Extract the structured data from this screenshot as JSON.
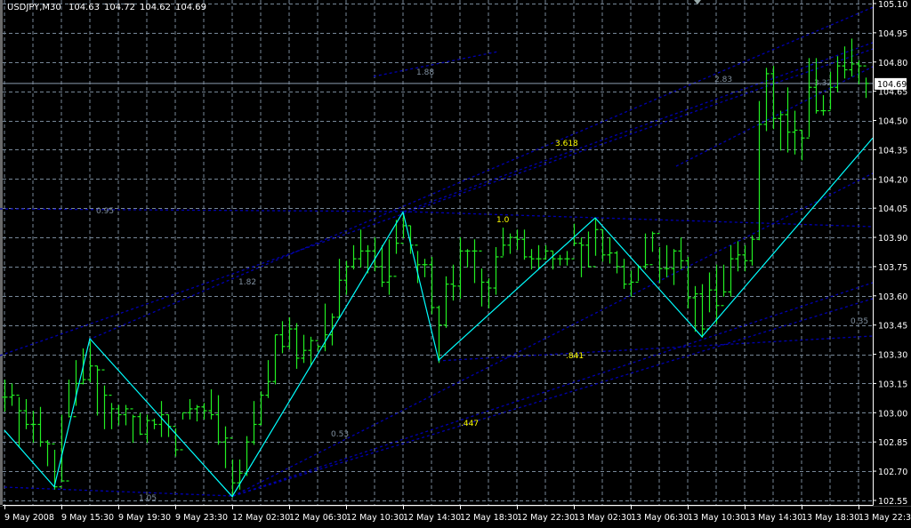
{
  "header": {
    "symbol": "USDJPY,M30",
    "open": "104.63",
    "high": "104.72",
    "low": "104.62",
    "close": "104.69"
  },
  "colors": {
    "background": "#000000",
    "grid": "#778899",
    "bars": "#22ee22",
    "zigzag": "#00ffff",
    "fib_lines": "#0000b0",
    "fib_label_gray": "#8090a0",
    "fib_label_yellow": "#ffff00",
    "axis": "#ffffff",
    "current_price_line": "#8c9cb0"
  },
  "chart_data": {
    "type": "ohlc-bar",
    "instrument": "USDJPY",
    "timeframe": "M30",
    "ylim": [
      102.55,
      105.1
    ],
    "y_ticks": [
      "105.10",
      "104.95",
      "104.80",
      "104.65",
      "104.50",
      "104.35",
      "104.20",
      "104.05",
      "103.90",
      "103.75",
      "103.60",
      "103.45",
      "103.30",
      "103.15",
      "103.00",
      "102.85",
      "102.70",
      "102.55"
    ],
    "x_ticks": [
      "9 May 2008",
      "9 May 15:30",
      "9 May 19:30",
      "9 May 23:30",
      "12 May 02:30",
      "12 May 06:30",
      "12 May 10:30",
      "12 May 14:30",
      "12 May 18:30",
      "12 May 22:30",
      "13 May 02:30",
      "13 May 06:30",
      "13 May 10:30",
      "13 May 14:30",
      "13 May 18:30",
      "13 May 22:30"
    ],
    "grid": true,
    "current_price": "104.69",
    "bars_hlc": [
      [
        103.17,
        103.01,
        103.08
      ],
      [
        103.15,
        103.04,
        103.09
      ],
      [
        103.08,
        102.83,
        103.01
      ],
      [
        103.07,
        102.92,
        102.94
      ],
      [
        103.01,
        102.85,
        102.94
      ],
      [
        103.03,
        102.83,
        102.85
      ],
      [
        102.86,
        102.73,
        102.84
      ],
      [
        102.81,
        102.61,
        102.62
      ],
      [
        102.99,
        102.65,
        102.65
      ],
      [
        103.17,
        102.98,
        102.98
      ],
      [
        103.27,
        103.04,
        103.15
      ],
      [
        103.33,
        103.15,
        103.17
      ],
      [
        103.37,
        103.16,
        103.24
      ],
      [
        103.24,
        102.99,
        103.22
      ],
      [
        103.14,
        102.92,
        103.09
      ],
      [
        103.05,
        102.92,
        103.02
      ],
      [
        103.04,
        102.94,
        102.99
      ],
      [
        103.04,
        102.94,
        103.02
      ],
      [
        102.99,
        102.85,
        102.98
      ],
      [
        103.0,
        102.89,
        102.89
      ],
      [
        102.99,
        102.85,
        102.96
      ],
      [
        102.97,
        102.92,
        102.94
      ],
      [
        103.06,
        102.88,
        102.99
      ],
      [
        102.99,
        102.88,
        102.93
      ],
      [
        102.92,
        102.78,
        102.81
      ],
      [
        103.0,
        102.97,
        103.0
      ],
      [
        103.07,
        102.97,
        103.02
      ],
      [
        103.04,
        102.96,
        103.03
      ],
      [
        103.05,
        102.97,
        103.01
      ],
      [
        103.12,
        102.97,
        102.99
      ],
      [
        103.09,
        102.84,
        102.85
      ],
      [
        102.93,
        102.72,
        102.87
      ],
      [
        102.76,
        102.57,
        102.64
      ],
      [
        102.76,
        102.61,
        102.69
      ],
      [
        102.88,
        102.68,
        102.85
      ],
      [
        103.06,
        102.84,
        102.94
      ],
      [
        103.11,
        102.94,
        103.09
      ],
      [
        103.27,
        103.08,
        103.16
      ],
      [
        103.4,
        103.15,
        103.4
      ],
      [
        103.47,
        103.31,
        103.34
      ],
      [
        103.49,
        103.33,
        103.43
      ],
      [
        103.46,
        103.23,
        103.28
      ],
      [
        103.4,
        103.26,
        103.32
      ],
      [
        103.39,
        103.25,
        103.37
      ],
      [
        103.35,
        103.32,
        103.34
      ],
      [
        103.56,
        103.32,
        103.4
      ],
      [
        103.51,
        103.35,
        103.49
      ],
      [
        103.79,
        103.49,
        103.68
      ],
      [
        103.78,
        103.61,
        103.75
      ],
      [
        103.86,
        103.74,
        103.79
      ],
      [
        103.94,
        103.75,
        103.83
      ],
      [
        103.86,
        103.72,
        103.83
      ],
      [
        103.9,
        103.73,
        103.75
      ],
      [
        103.86,
        103.65,
        103.67
      ],
      [
        103.89,
        103.61,
        103.7
      ],
      [
        103.99,
        103.82,
        103.87
      ],
      [
        104.02,
        103.9,
        103.96
      ],
      [
        103.96,
        103.82,
        103.86
      ],
      [
        103.83,
        103.67,
        103.76
      ],
      [
        103.79,
        103.7,
        103.76
      ],
      [
        103.8,
        103.51,
        103.54
      ],
      [
        103.55,
        103.26,
        103.45
      ],
      [
        103.7,
        103.44,
        103.66
      ],
      [
        103.76,
        103.58,
        103.65
      ],
      [
        103.9,
        103.59,
        103.83
      ],
      [
        103.84,
        103.75,
        103.83
      ],
      [
        103.89,
        103.67,
        103.83
      ],
      [
        103.74,
        103.55,
        103.67
      ],
      [
        103.69,
        103.54,
        103.64
      ],
      [
        103.85,
        103.61,
        103.8
      ],
      [
        103.95,
        103.81,
        103.86
      ],
      [
        103.92,
        103.82,
        103.9
      ],
      [
        103.94,
        103.84,
        103.89
      ],
      [
        103.94,
        103.79,
        103.8
      ],
      [
        103.84,
        103.74,
        103.79
      ],
      [
        103.86,
        103.74,
        103.79
      ],
      [
        103.86,
        103.79,
        103.83
      ],
      [
        103.83,
        103.74,
        103.79
      ],
      [
        103.81,
        103.76,
        103.79
      ],
      [
        103.83,
        103.76,
        103.79
      ],
      [
        103.97,
        103.86,
        103.87
      ],
      [
        103.9,
        103.7,
        103.86
      ],
      [
        103.93,
        103.75,
        103.75
      ],
      [
        104.0,
        103.81,
        103.94
      ],
      [
        103.94,
        103.78,
        103.81
      ],
      [
        103.9,
        103.77,
        103.82
      ],
      [
        103.83,
        103.72,
        103.75
      ],
      [
        103.79,
        103.64,
        103.66
      ],
      [
        103.73,
        103.6,
        103.67
      ],
      [
        103.76,
        103.68,
        103.75
      ],
      [
        103.92,
        103.74,
        103.76
      ],
      [
        103.93,
        103.83,
        103.92
      ],
      [
        103.85,
        103.67,
        103.74
      ],
      [
        103.86,
        103.7,
        103.74
      ],
      [
        103.84,
        103.66,
        103.83
      ],
      [
        103.9,
        103.74,
        103.78
      ],
      [
        103.8,
        103.54,
        103.59
      ],
      [
        103.65,
        103.42,
        103.61
      ],
      [
        103.66,
        103.39,
        103.43
      ],
      [
        103.72,
        103.52,
        103.63
      ],
      [
        103.76,
        103.46,
        103.55
      ],
      [
        103.76,
        103.6,
        103.62
      ],
      [
        103.86,
        103.6,
        103.79
      ],
      [
        103.88,
        103.73,
        103.81
      ],
      [
        103.86,
        103.73,
        103.78
      ],
      [
        103.91,
        103.76,
        103.89
      ],
      [
        104.6,
        103.89,
        104.48
      ],
      [
        104.77,
        104.45,
        104.74
      ],
      [
        104.78,
        104.46,
        104.51
      ],
      [
        104.55,
        104.35,
        104.53
      ],
      [
        104.67,
        104.34,
        104.44
      ],
      [
        104.55,
        104.33,
        104.45
      ],
      [
        104.45,
        104.3,
        104.41
      ],
      [
        104.82,
        104.42,
        104.67
      ],
      [
        104.82,
        104.54,
        104.55
      ],
      [
        104.63,
        104.53,
        104.55
      ],
      [
        104.75,
        104.56,
        104.67
      ],
      [
        104.83,
        104.65,
        104.78
      ],
      [
        104.88,
        104.72,
        104.76
      ],
      [
        104.92,
        104.73,
        104.79
      ],
      [
        104.81,
        104.69,
        104.78
      ],
      [
        104.72,
        104.62,
        104.69
      ]
    ],
    "zigzag": [
      {
        "bar": 0,
        "price": 102.91
      },
      {
        "bar": 7,
        "price": 102.62
      },
      {
        "bar": 12,
        "price": 103.38
      },
      {
        "bar": 32,
        "price": 102.57
      },
      {
        "bar": 56,
        "price": 104.03
      },
      {
        "bar": 61,
        "price": 103.27
      },
      {
        "bar": 83,
        "price": 104.0
      },
      {
        "bar": 98,
        "price": 103.39
      },
      {
        "bar": 122,
        "price": 104.41
      }
    ],
    "fib_labels": [
      {
        "text": "1.88",
        "color": "gray"
      },
      {
        "text": "2.83",
        "color": "gray"
      },
      {
        "text": "3.32",
        "color": "gray"
      },
      {
        "text": "3.618",
        "color": "yellow"
      },
      {
        "text": "0.95",
        "color": "gray"
      },
      {
        "text": "1.0",
        "color": "yellow"
      },
      {
        "text": "1.82",
        "color": "gray"
      },
      {
        "text": ".841",
        "color": "yellow"
      },
      {
        "text": "0.35",
        "color": "gray"
      },
      {
        "text": ".447",
        "color": "yellow"
      },
      {
        "text": "0.53",
        "color": "gray"
      },
      {
        "text": "1.05",
        "color": "gray"
      }
    ]
  }
}
